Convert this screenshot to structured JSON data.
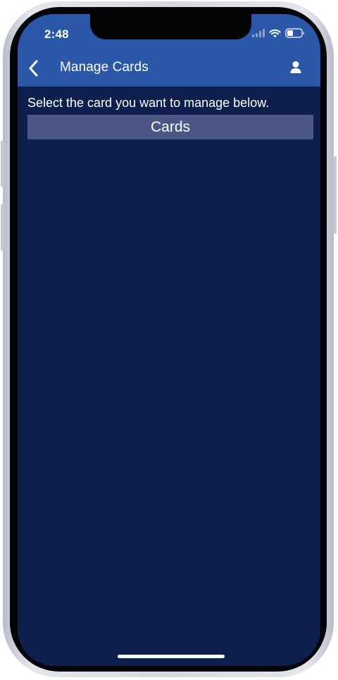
{
  "status_bar": {
    "time": "2:48"
  },
  "nav": {
    "title": "Manage Cards",
    "back_icon": "chevron-left-icon",
    "profile_icon": "person-icon"
  },
  "content": {
    "instruction": "Select the card you want to manage below.",
    "section_header": "Cards"
  },
  "colors": {
    "header_blue": "#2a57a8",
    "background_navy": "#0f1f4d",
    "section_header_bg": "#4b5687"
  }
}
